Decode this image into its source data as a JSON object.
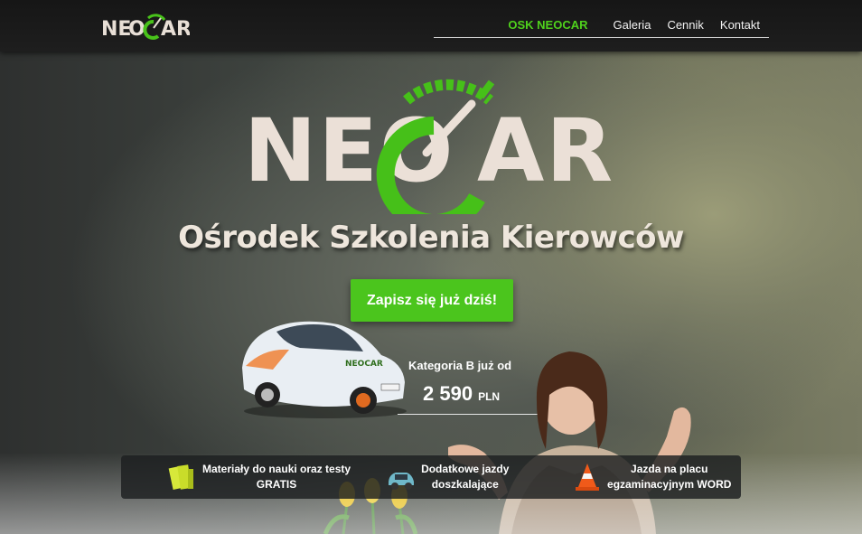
{
  "nav": {
    "logo_text": "NEOCAR",
    "menu": [
      {
        "label": "OSK NEOCAR",
        "active": true
      },
      {
        "label": "Galeria",
        "active": false
      },
      {
        "label": "Cennik",
        "active": false
      },
      {
        "label": "Kontakt",
        "active": false
      }
    ]
  },
  "hero": {
    "logo_left": "NEO",
    "logo_right": "AR",
    "subtitle": "Ośrodek Szkolenia Kierowców",
    "cta_label": "Zapisz się już dziś!",
    "price": {
      "label": "Kategoria B już  od",
      "value": "2 590",
      "unit": "PLN"
    }
  },
  "features": [
    {
      "line1": "Materiały do nauki oraz testy",
      "line2": "GRATIS",
      "icon": "books-icon"
    },
    {
      "line1": "Dodatkowe jazdy",
      "line2": "doszkalające",
      "icon": "car-icon"
    },
    {
      "line1": "Jazda na placu",
      "line2": "egzaminacyjnym WORD",
      "icon": "traffic-cone-icon"
    }
  ],
  "colors": {
    "accent_green": "#4bc51d",
    "nav_active": "#4fd11c",
    "nav_bg": "#1a1a1a"
  }
}
